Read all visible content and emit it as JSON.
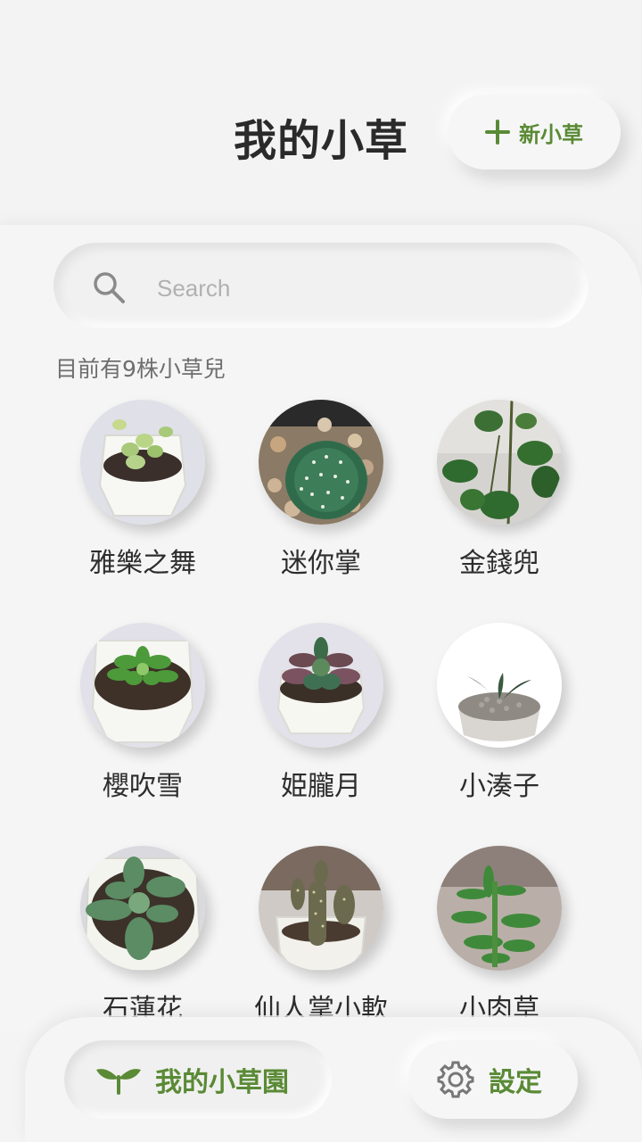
{
  "header": {
    "title": "我的小草",
    "new_button_label": "新小草"
  },
  "search": {
    "placeholder": "Search"
  },
  "count_text": "目前有9株小草兒",
  "plants": [
    {
      "name": "雅樂之舞"
    },
    {
      "name": "迷你掌"
    },
    {
      "name": "金錢兜"
    },
    {
      "name": "櫻吹雪"
    },
    {
      "name": "姫朧月"
    },
    {
      "name": "小湊子"
    },
    {
      "name": "石蓮花"
    },
    {
      "name": "仙人掌小軟"
    },
    {
      "name": "小肉草"
    }
  ],
  "bottom_nav": {
    "garden_label": "我的小草園",
    "settings_label": "設定"
  },
  "colors": {
    "accent": "#5a8a35",
    "background": "#f2f2f2",
    "text": "#2d2d2d"
  },
  "icons": [
    "plus-icon",
    "search-icon",
    "sprout-icon",
    "gear-icon"
  ]
}
